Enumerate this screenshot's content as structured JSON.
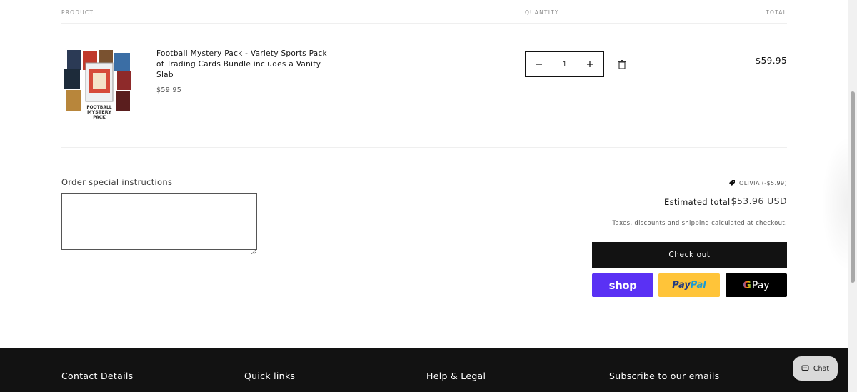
{
  "table_headers": {
    "product": "PRODUCT",
    "quantity": "QUANTITY",
    "total": "TOTAL"
  },
  "cart_item": {
    "title": "Football Mystery Pack - Variety Sports Pack of Trading Cards Bundle includes a Vanity Slab",
    "price": "$59.95",
    "quantity": "1",
    "line_total": "$59.95",
    "image_icon": "trading-cards-product-image"
  },
  "instructions": {
    "label": "Order special instructions",
    "value": ""
  },
  "summary": {
    "discount": "OLIVIA (-$5.99)",
    "estimated_label": "Estimated total",
    "estimated_value": "$53.96 USD",
    "tax_prefix": "Taxes, discounts and ",
    "tax_link": "shipping",
    "tax_suffix": " calculated at checkout."
  },
  "buttons": {
    "checkout": "Check out",
    "shop_pay": "shop",
    "paypal_1": "Pay",
    "paypal_2": "Pal",
    "gpay_g": "G",
    "gpay_text": "Pay"
  },
  "footer": {
    "contact": "Contact Details",
    "quick_links": "Quick links",
    "help": "Help & Legal",
    "subscribe": "Subscribe to our emails"
  },
  "chat": {
    "label": "Chat"
  },
  "colors": {
    "shop_pay": "#5a31f4",
    "paypal": "#ffc439",
    "footer_bg": "#121212",
    "checkout_bg": "#121212"
  }
}
